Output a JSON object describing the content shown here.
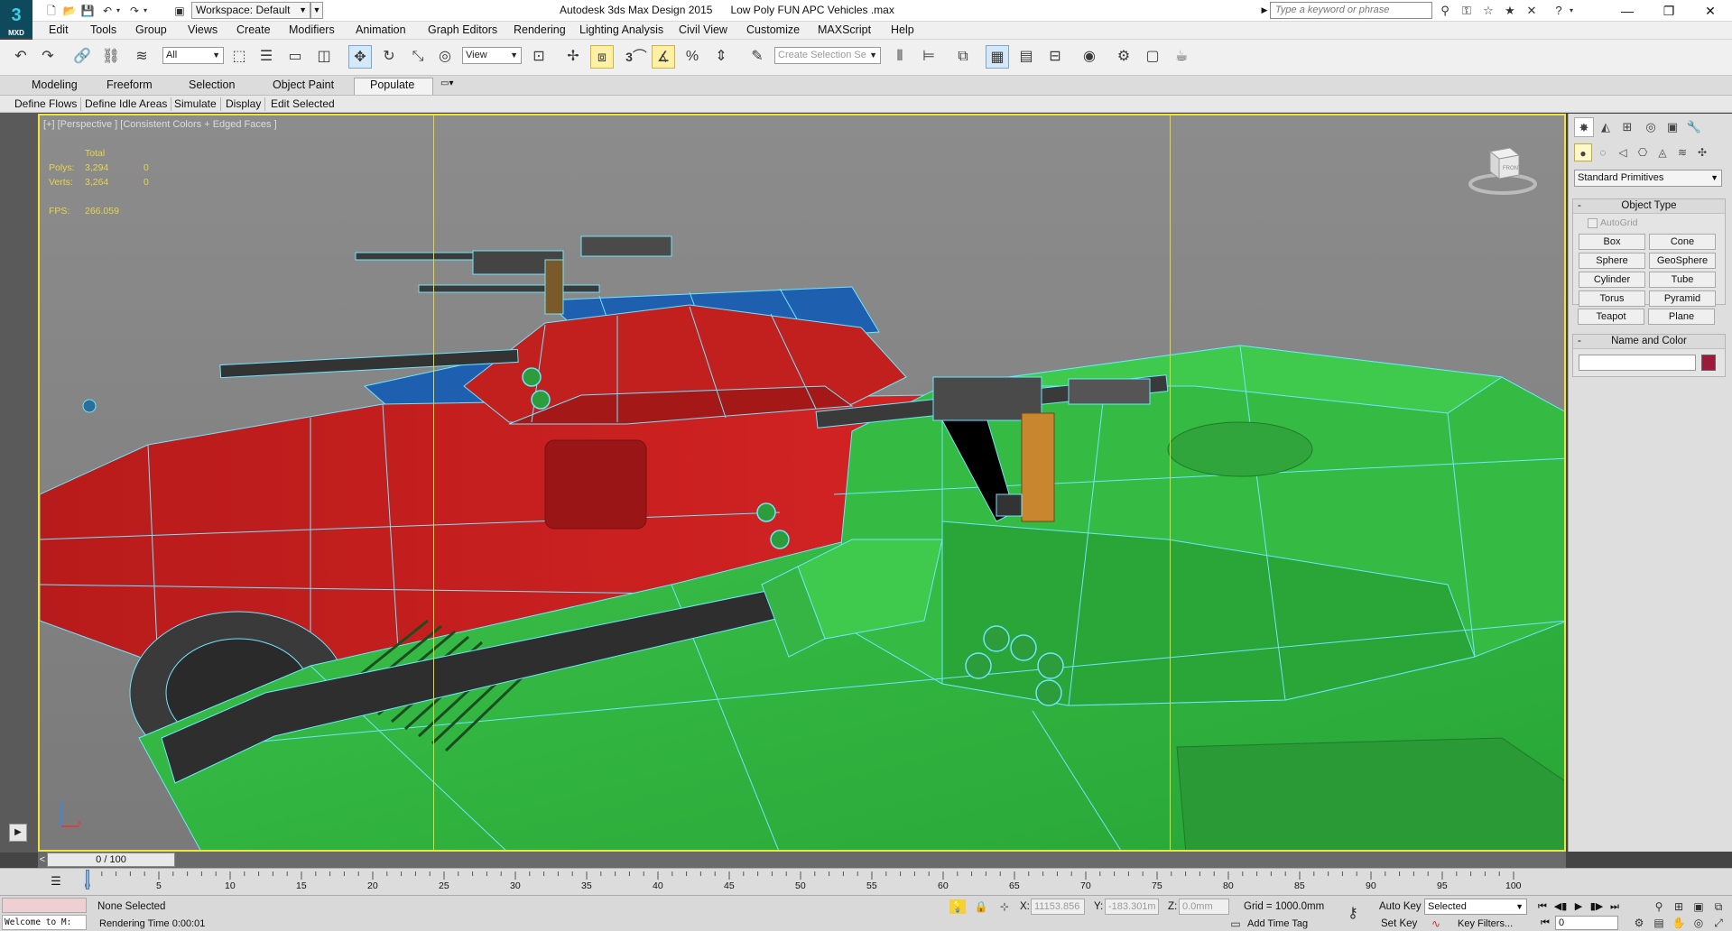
{
  "window": {
    "title": "Autodesk 3ds Max Design 2015      Low Poly FUN APC Vehicles .max",
    "logo": "3",
    "logo_sub": "MXD",
    "workspace": "Workspace: Default",
    "search_placeholder": "Type a keyword or phrase"
  },
  "menu": [
    "Edit",
    "Tools",
    "Group",
    "Views",
    "Create",
    "Modifiers",
    "Animation",
    "Graph Editors",
    "Rendering",
    "Lighting Analysis",
    "Civil View",
    "Customize",
    "MAXScript",
    "Help"
  ],
  "toolbar": {
    "selection_filter": "All",
    "reference_coord": "View",
    "snap_value": "3",
    "selection_set_placeholder": "Create Selection Se"
  },
  "ribbon": {
    "tabs": [
      "Modeling",
      "Freeform",
      "Selection",
      "Object Paint",
      "Populate"
    ],
    "active_tab": "Populate",
    "panels": [
      "Define Flows",
      "Define Idle Areas",
      "Simulate",
      "Display",
      "Edit Selected"
    ]
  },
  "viewport": {
    "label": "[+] [Perspective ] [Consistent Colors + Edged Faces ]",
    "stats": {
      "header": "Total",
      "polys_label": "Polys:",
      "polys_total": "3,294",
      "polys_sel": "0",
      "verts_label": "Verts:",
      "verts_total": "3,264",
      "verts_sel": "0",
      "fps_label": "FPS:",
      "fps_value": "266.059"
    },
    "viewcube_label": "FRONT",
    "axis_z": "z",
    "axis_x": "x"
  },
  "command_panel": {
    "category": "Standard Primitives",
    "object_type_title": "Object Type",
    "autogrid": "AutoGrid",
    "primitives": [
      "Box",
      "Cone",
      "Sphere",
      "GeoSphere",
      "Cylinder",
      "Tube",
      "Torus",
      "Pyramid",
      "Teapot",
      "Plane"
    ],
    "name_color_title": "Name and Color",
    "object_color": "#9c1a3c"
  },
  "timeline": {
    "frame_readout": "0 / 100",
    "prev": "<",
    "next": ">",
    "ticks": [
      0,
      5,
      10,
      15,
      20,
      25,
      30,
      35,
      40,
      45,
      50,
      55,
      60,
      65,
      70,
      75,
      80,
      85,
      90,
      95,
      100
    ]
  },
  "status": {
    "welcome": "Welcome to M:",
    "selection": "None Selected",
    "render_time": "Rendering Time  0:00:01",
    "x_label": "X:",
    "x_value": "11153.856",
    "y_label": "Y:",
    "y_value": "-183.301m",
    "z_label": "Z:",
    "z_value": "0.0mm",
    "grid": "Grid = 1000.0mm",
    "add_time_tag": "Add Time Tag",
    "auto_key": "Auto Key",
    "set_key": "Set Key",
    "key_mode": "Selected",
    "key_filters": "Key Filters...",
    "current_frame": "0"
  },
  "colors": {
    "viewport_border": "#f2e23a",
    "red_vehicle": "#c41f1f",
    "green_vehicle": "#2fb53e",
    "blue_vehicle": "#1f5fb0",
    "wire": "#6fe6ff"
  }
}
